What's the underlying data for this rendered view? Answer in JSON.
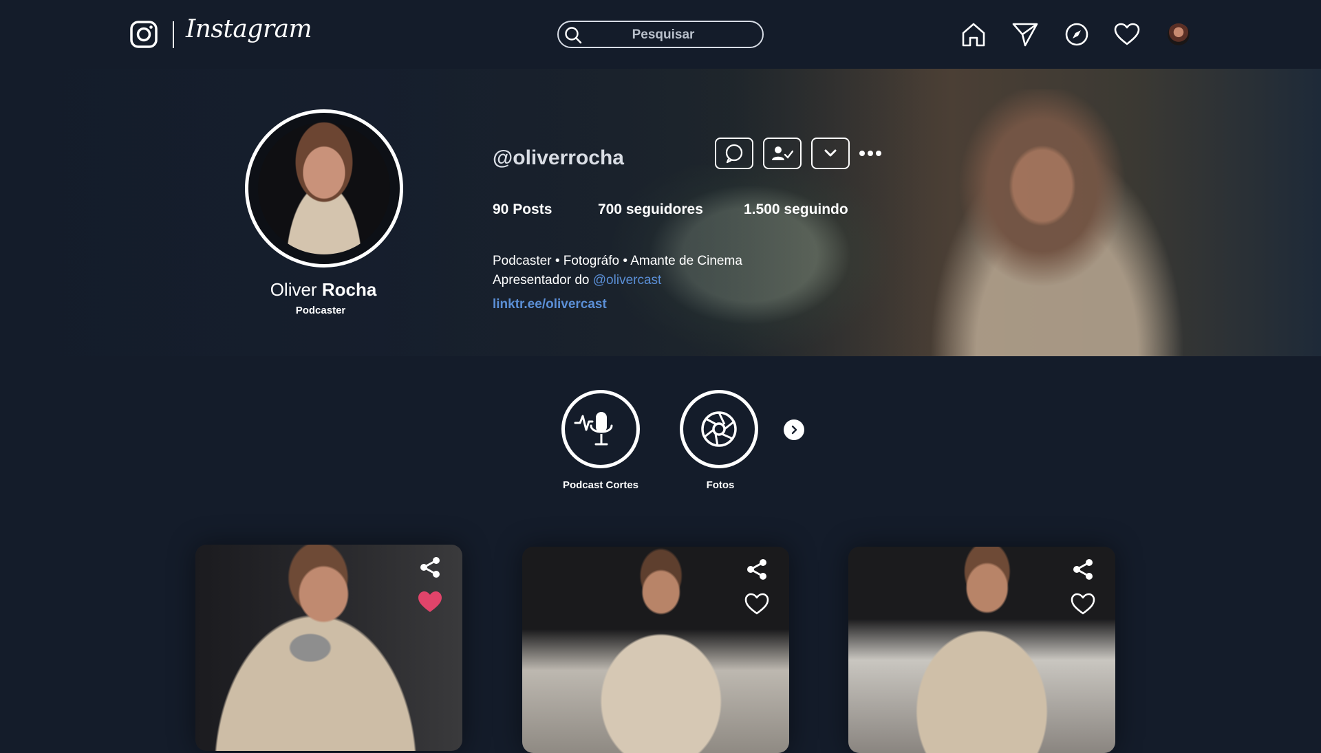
{
  "app": {
    "name": "Instagram"
  },
  "search": {
    "placeholder": "Pesquisar"
  },
  "nav": {
    "items": [
      "home-icon",
      "direct-icon",
      "explore-icon",
      "notifications-icon",
      "profile-avatar"
    ]
  },
  "profile": {
    "username": "@oliverrocha",
    "first_name": "Oliver",
    "last_name": "Rocha",
    "role": "Podcaster",
    "stats": {
      "posts": "90 Posts",
      "followers": "700 seguidores",
      "following": "1.500 seguindo"
    },
    "bio_line1": "Podcaster • Fotográfo • Amante de Cinema",
    "bio_line2_prefix": "Apresentador do ",
    "bio_mention": "@olivercast",
    "link": "linktr.ee/olivercast"
  },
  "highlights": [
    {
      "label": "Podcast Cortes",
      "icon": "podcast-mic-icon"
    },
    {
      "label": "Fotos",
      "icon": "camera-aperture-icon"
    }
  ],
  "posts": [
    {
      "liked": true
    },
    {
      "liked": false
    },
    {
      "liked": false
    }
  ],
  "colors": {
    "background": "#141c2a",
    "link": "#5b8fd6",
    "like": "#e0446a"
  }
}
